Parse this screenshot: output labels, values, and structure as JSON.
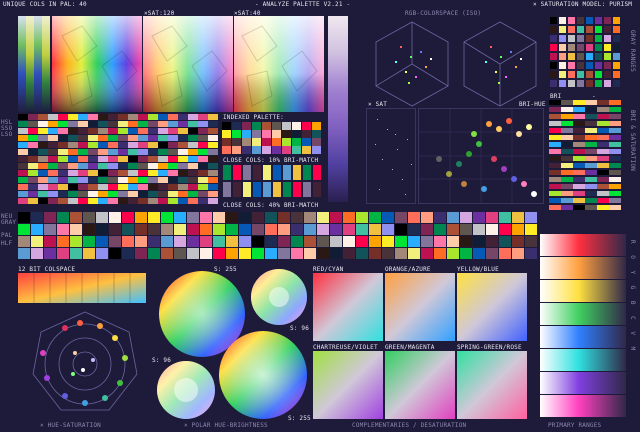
{
  "header": {
    "unique_cols": "UNIQUE COLS IN PAL: 40",
    "title": "- ANALYZE PALETTE V2.21 -",
    "sat_mode": "× SATURATION MODEL: PURISM",
    "sat_120": "×SAT:120",
    "sat_40": "×SAT:40",
    "rgb_colorspace": "RGB-COLORSPACE (ISO)"
  },
  "scatter": {
    "sat_label": "× SAT",
    "bri_hue_label": "BRI-HUE"
  },
  "bri_panel": {
    "label": "BRI",
    "dash_label": "-"
  },
  "side_labels": {
    "left_top": [
      "NEU",
      "GRAY"
    ],
    "left_mid": [
      "PAL",
      "HLF"
    ],
    "left_upper": [
      "HSL",
      "SSO",
      "LSO"
    ],
    "right_top": "GRAY RANGES",
    "right_mid": "BRI & SATURATION",
    "right_bottom": "R O Y G B C V M"
  },
  "indexed": {
    "label": "INDEXED PALETTE:",
    "close_cols_10": "CLOSE COLS: 10% BRI-MATCH",
    "close_cols_40": "CLOSE COLS: 40% BRI-MATCH"
  },
  "colspace": {
    "label": "12 BIT COLSPACE"
  },
  "polar": {
    "s255_top": "S: 255",
    "s96_right": "S: 96",
    "s96_left": "S: 96",
    "s255_bottom": "S: 255"
  },
  "complement_panels": [
    {
      "label": "RED/CYAN"
    },
    {
      "label": "ORANGE/AZURE"
    },
    {
      "label": "YELLOW/BLUE"
    },
    {
      "label": "CHARTREUSE/VIOLET"
    },
    {
      "label": "GREEN/MAGENTA"
    },
    {
      "label": "SPRING-GREEN/ROSE"
    }
  ],
  "footer": {
    "hue_saturation": "× HUE-SATURATION",
    "polar_hue_brightness": "× POLAR HUE-BRIGHTNESS",
    "complementaries": "COMPLEMENTARIES / DESATURATION",
    "primary_ranges": "PRIMARY RANGES"
  },
  "palette": [
    "#000000",
    "#1d2b53",
    "#7e2553",
    "#008751",
    "#ab5236",
    "#5f574f",
    "#c2c3c7",
    "#fff1e8",
    "#ff004d",
    "#ffa300",
    "#ffec27",
    "#00e436",
    "#29adff",
    "#83769c",
    "#ff77a8",
    "#ffccaa",
    "#291814",
    "#111d35",
    "#422136",
    "#125359",
    "#742f29",
    "#49333b",
    "#a28879",
    "#f3ef7d",
    "#be1250",
    "#ff6c24",
    "#a8e72e",
    "#00b543",
    "#065ab5",
    "#754665",
    "#ff6e59",
    "#ff9d81",
    "#3a2e6e",
    "#5a9bd4",
    "#d5a6e0",
    "#6b2fa0",
    "#e04080",
    "#40c0a0",
    "#f0c040",
    "#9090f0"
  ]
}
